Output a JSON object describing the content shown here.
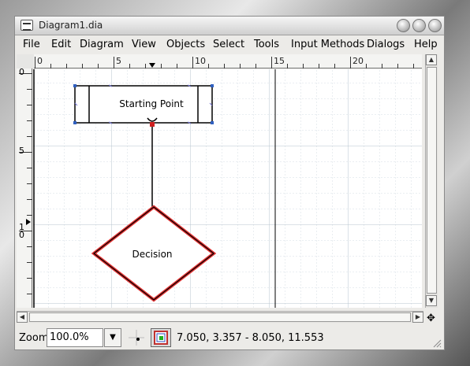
{
  "window": {
    "title": "Diagram1.dia"
  },
  "menu": [
    {
      "label": "File"
    },
    {
      "label": "Edit"
    },
    {
      "label": "Diagram"
    },
    {
      "label": "View"
    },
    {
      "label": "Objects"
    },
    {
      "label": "Select"
    },
    {
      "label": "Tools"
    },
    {
      "label": "Input Methods"
    },
    {
      "label": "Dialogs"
    },
    {
      "label": "Help"
    }
  ],
  "ruler_top": {
    "ticks": [
      "0",
      "5",
      "10",
      "15",
      "20"
    ]
  },
  "ruler_left": {
    "ticks": [
      "0",
      "5",
      "1\n0"
    ]
  },
  "diagram": {
    "process_label": "Starting Point",
    "decision_label": "Decision",
    "highlight_color": "#e03030",
    "connector_color": "#000000"
  },
  "status": {
    "zoom_label": "Zoom",
    "zoom_value": "100.0%",
    "coordinates": "7.050, 3.357 - 8.050, 11.553"
  }
}
